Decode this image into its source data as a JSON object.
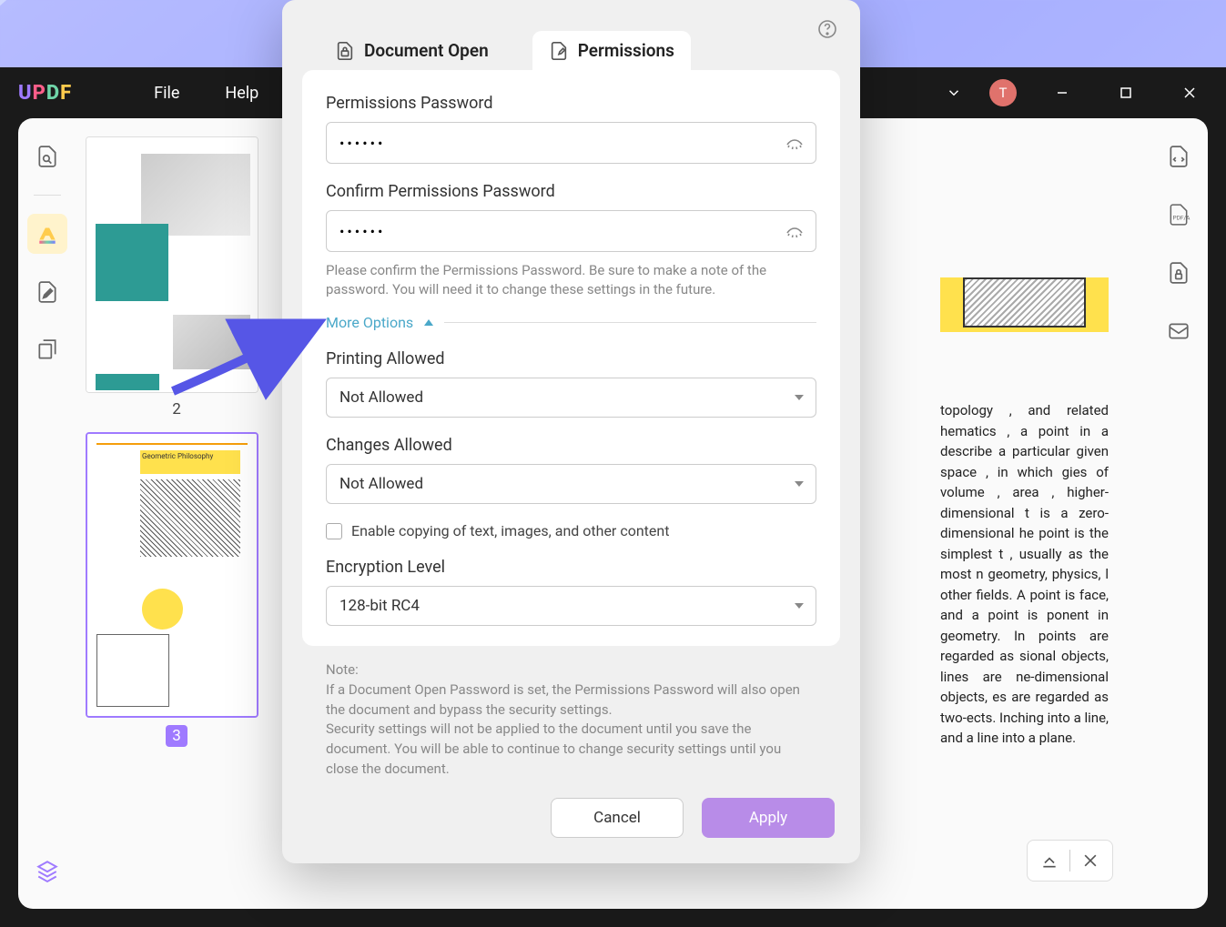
{
  "app": {
    "logo": "UPDF",
    "avatar_initial": "T"
  },
  "menu": {
    "file": "File",
    "help": "Help"
  },
  "thumbs": {
    "p2": "2",
    "p3": "3",
    "gp_title": "Geometric Philosophy"
  },
  "doc": {
    "body": "topology , and related hematics , a point in a describe a particular given space , in which gies of volume , area , higher-dimensional t is a zero-dimensional he point is the simplest t , usually as the most n geometry, physics, l other fields. A point is face, and a point is ponent in geometry. In points are regarded as sional objects, lines are ne-dimensional objects, es are regarded as two-ects. Inching into a line, and a line into a plane."
  },
  "dialog": {
    "tabs": {
      "open": "Document Open",
      "perms": "Permissions"
    },
    "perm_pw_label": "Permissions Password",
    "perm_pw_value": "••••••",
    "confirm_pw_label": "Confirm Permissions Password",
    "confirm_pw_value": "••••••",
    "confirm_hint": "Please confirm the Permissions Password. Be sure to make a note of the password. You will need it to change these settings in the future.",
    "more_options": "More Options",
    "printing_label": "Printing Allowed",
    "printing_value": "Not Allowed",
    "changes_label": "Changes Allowed",
    "changes_value": "Not Allowed",
    "copy_check": "Enable copying of text, images, and other content",
    "enc_label": "Encryption Level",
    "enc_value": "128-bit RC4",
    "note_title": "Note:",
    "note_1": "If a Document Open Password is set, the Permissions Password will also open the document and bypass the security settings.",
    "note_2": "Security settings will not be applied to the document until you save the document. You will be able to continue to change security settings until you close the document.",
    "cancel": "Cancel",
    "apply": "Apply"
  }
}
